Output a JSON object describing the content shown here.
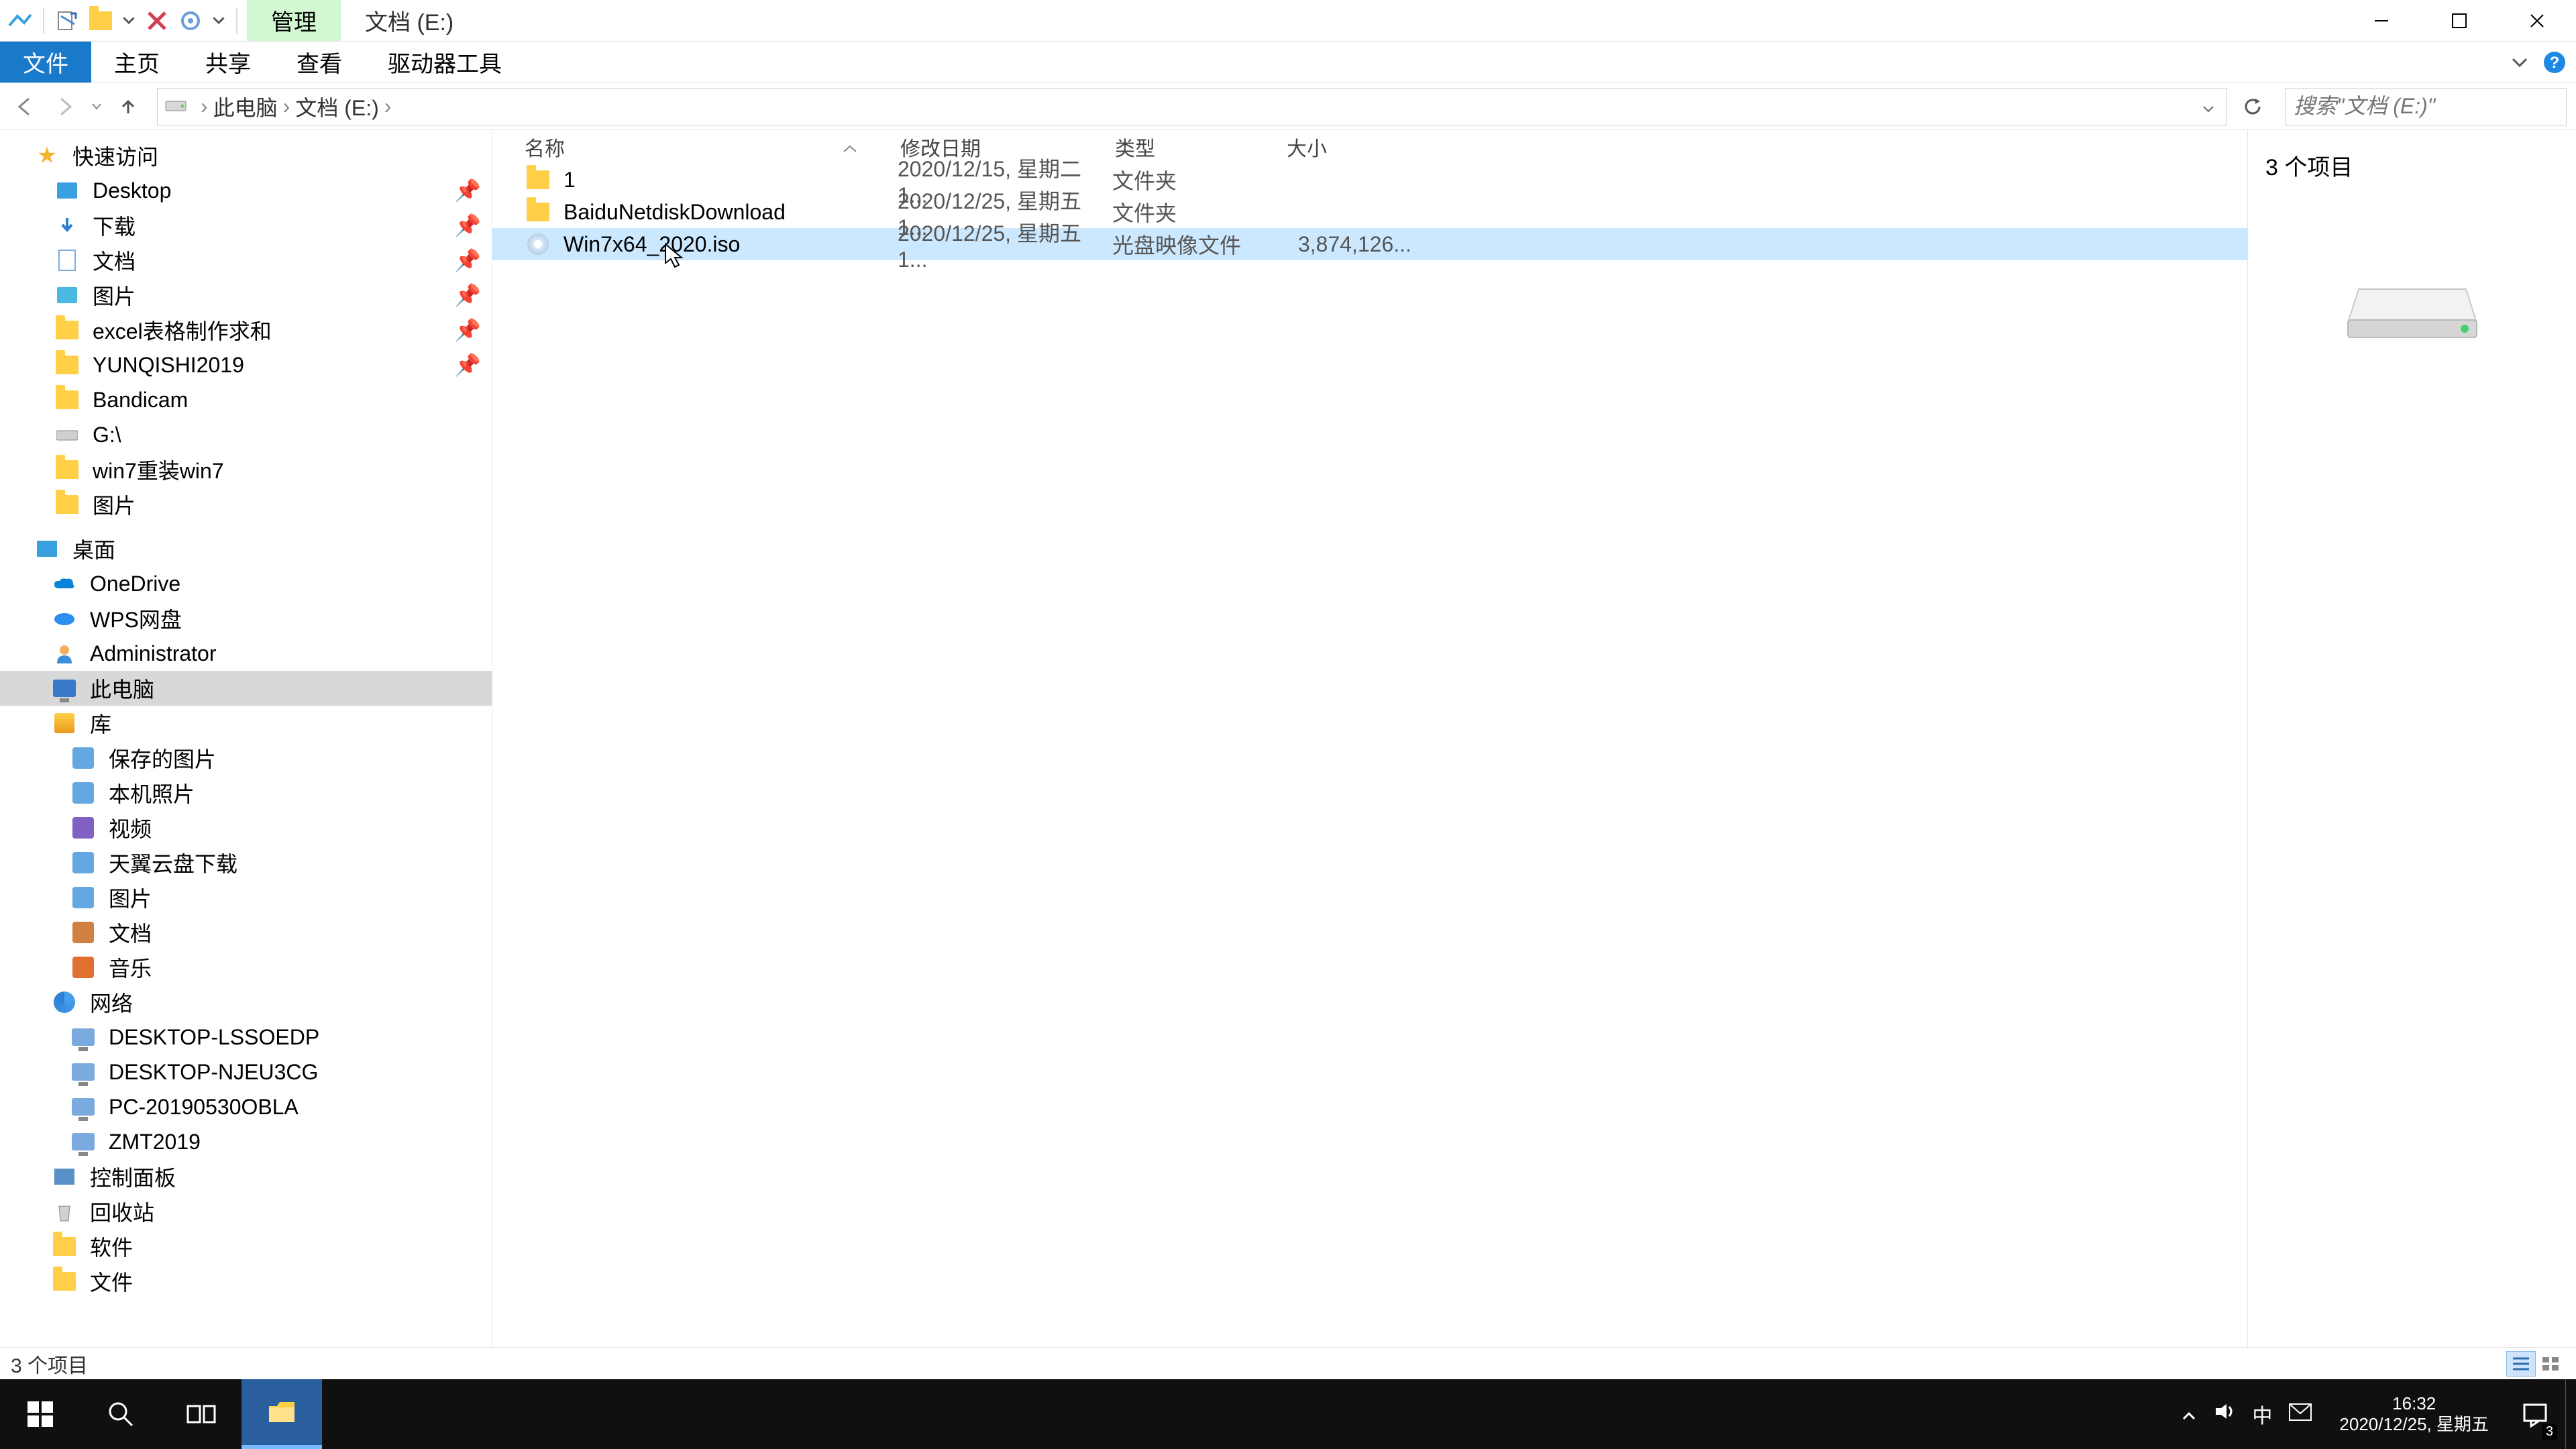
{
  "titlebar": {
    "manage_tab": "管理",
    "location_tab": "文档 (E:)"
  },
  "ribbon": {
    "file": "文件",
    "home": "主页",
    "share": "共享",
    "view": "查看",
    "drive_tools": "驱动器工具"
  },
  "breadcrumb": {
    "pc": "此电脑",
    "drive": "文档 (E:)"
  },
  "search": {
    "placeholder": "搜索\"文档 (E:)\""
  },
  "nav": {
    "quick_access": "快速访问",
    "desktop": "Desktop",
    "downloads": "下载",
    "documents": "文档",
    "pictures": "图片",
    "excel": "excel表格制作求和",
    "yunqishi": "YUNQISHI2019",
    "bandicam": "Bandicam",
    "gdrive": "G:\\",
    "win7reinstall": "win7重装win7",
    "pictures2": "图片",
    "desktop_zh": "桌面",
    "onedrive": "OneDrive",
    "wps": "WPS网盘",
    "admin": "Administrator",
    "this_pc": "此电脑",
    "library": "库",
    "saved_pictures": "保存的图片",
    "local_photos": "本机照片",
    "video": "视频",
    "tianyi": "天翼云盘下载",
    "pictures3": "图片",
    "documents2": "文档",
    "music": "音乐",
    "network": "网络",
    "desk_lssoedp": "DESKTOP-LSSOEDP",
    "desk_njeu": "DESKTOP-NJEU3CG",
    "pc2019": "PC-20190530OBLA",
    "zmt": "ZMT2019",
    "control_panel": "控制面板",
    "recycle": "回收站",
    "software": "软件",
    "files": "文件"
  },
  "columns": {
    "name": "名称",
    "date": "修改日期",
    "type": "类型",
    "size": "大小"
  },
  "files": {
    "r0": {
      "name": "1",
      "date": "2020/12/15, 星期二 1...",
      "type": "文件夹",
      "size": ""
    },
    "r1": {
      "name": "BaiduNetdiskDownload",
      "date": "2020/12/25, 星期五 1...",
      "type": "文件夹",
      "size": ""
    },
    "r2": {
      "name": "Win7x64_2020.iso",
      "date": "2020/12/25, 星期五 1...",
      "type": "光盘映像文件",
      "size": "3,874,126..."
    }
  },
  "preview": {
    "item_count": "3 个项目"
  },
  "statusbar": {
    "items": "3 个项目"
  },
  "taskbar": {
    "time": "16:32",
    "date": "2020/12/25, 星期五",
    "ime": "中",
    "notif_badge": "3"
  }
}
